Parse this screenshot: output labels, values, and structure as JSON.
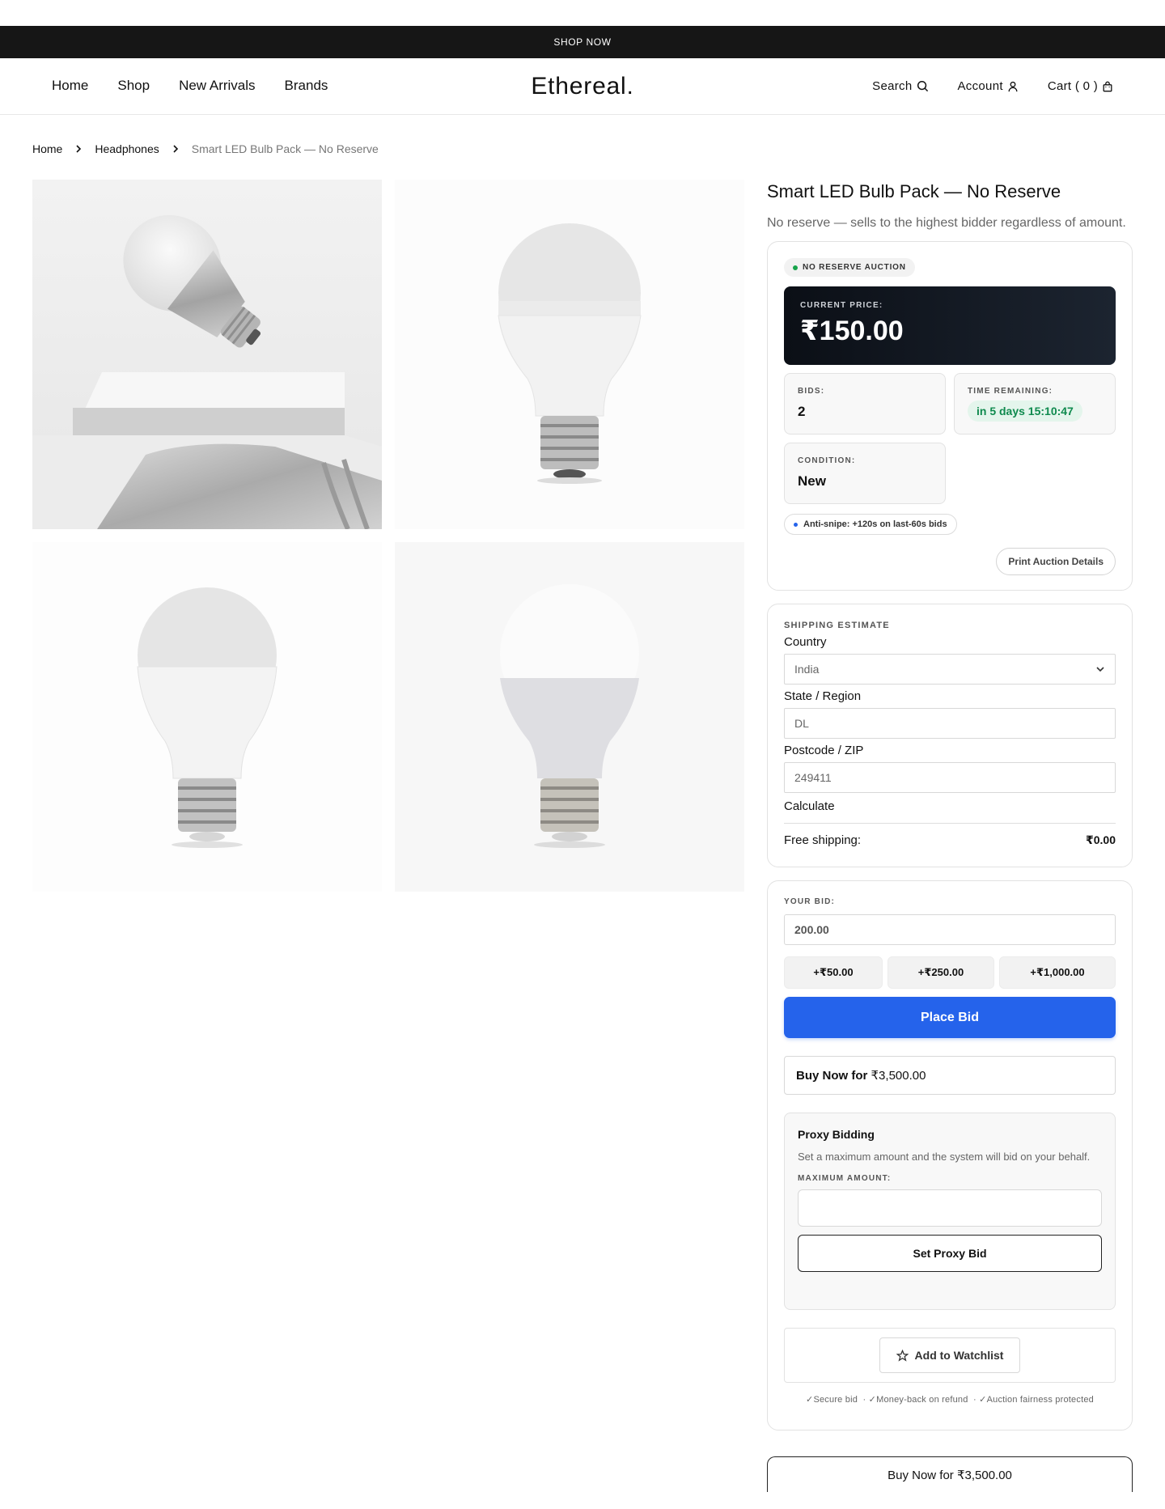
{
  "topbar": {
    "text": "SHOP NOW"
  },
  "nav": {
    "items": [
      "Home",
      "Shop",
      "New Arrivals",
      "Brands"
    ]
  },
  "logo": "Ethereal.",
  "header_right": {
    "search": "Search",
    "account": "Account",
    "cart": "Cart ( 0 )"
  },
  "breadcrumb": {
    "home": "Home",
    "category": "Headphones",
    "current": "Smart LED Bulb Pack — No Reserve"
  },
  "product": {
    "title": "Smart LED Bulb Pack — No Reserve",
    "subtitle": "No reserve — sells to the highest bidder regardless of amount."
  },
  "auction": {
    "badge": "NO RESERVE AUCTION",
    "badge_color": "#16a34a",
    "current_price_label": "CURRENT PRICE:",
    "current_price": "₹150.00",
    "bids_label": "BIDS:",
    "bids": "2",
    "time_label": "TIME REMAINING:",
    "time": "in 5 days 15:10:47",
    "condition_label": "CONDITION:",
    "condition": "New",
    "antisnipe": "Anti-snipe: +120s on last-60s bids",
    "antisnipe_color": "#2563eb",
    "print_button": "Print Auction Details"
  },
  "shipping": {
    "heading": "SHIPPING ESTIMATE",
    "country_label": "Country",
    "country_value": "India",
    "state_label": "State / Region",
    "state_placeholder": "DL",
    "zip_label": "Postcode / ZIP",
    "zip_placeholder": "249411",
    "calculate": "Calculate",
    "free_label": "Free shipping:",
    "free_value": "₹0.00"
  },
  "bid": {
    "label": "YOUR BID:",
    "value": "200.00",
    "increments": [
      "+₹50.00",
      "+₹250.00",
      "+₹1,000.00"
    ],
    "place_button": "Place Bid",
    "accent": "#2563eb",
    "buy_now_label": "Buy Now for",
    "buy_now_price": "₹3,500.00"
  },
  "proxy": {
    "title": "Proxy Bidding",
    "description": "Set a maximum amount and the system will bid on your behalf.",
    "max_label": "MAXIMUM AMOUNT:",
    "button": "Set Proxy Bid"
  },
  "watchlist": {
    "button": "Add to Watchlist",
    "icon": "star-icon"
  },
  "trust": "✓Secure bid  · ✓Money-back on refund  · ✓Auction fairness protected",
  "bottom_buy": "Buy Now for ₹3,500.00"
}
